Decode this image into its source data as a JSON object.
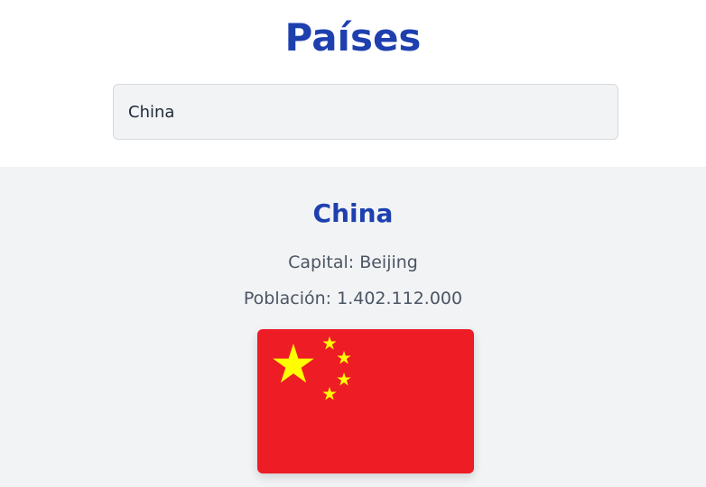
{
  "page": {
    "title": "Países",
    "accent_color": "#1e40af"
  },
  "search": {
    "value": "China"
  },
  "result": {
    "country": "China",
    "capital_label": "Capital:",
    "capital": "Beijing",
    "population_label": "Población:",
    "population": "1.402.112.000",
    "flag": {
      "icon": "china-flag-image",
      "background_color": "#ee1c25",
      "star_color": "#ffff00"
    }
  }
}
